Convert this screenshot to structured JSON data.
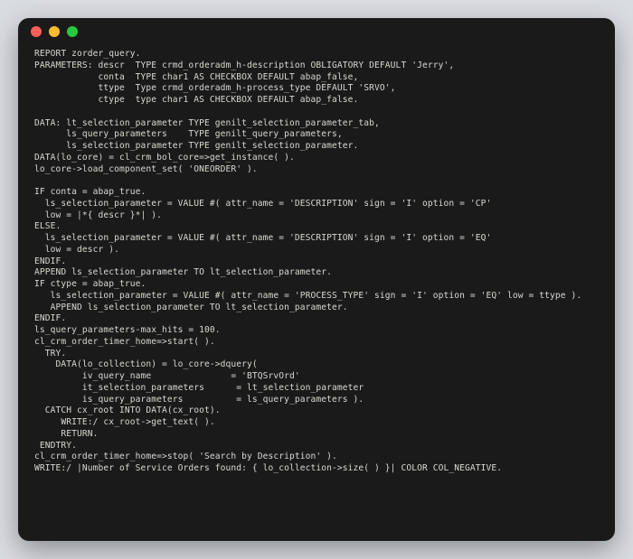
{
  "window": {
    "traffic_lights": {
      "close": "close",
      "minimize": "minimize",
      "maximize": "maximize"
    }
  },
  "code": "REPORT zorder_query.\nPARAMETERS: descr  TYPE crmd_orderadm_h-description OBLIGATORY DEFAULT 'Jerry',\n            conta  TYPE char1 AS CHECKBOX DEFAULT abap_false,\n            ttype  Type crmd_orderadm_h-process_type DEFAULT 'SRVO',\n            ctype  type char1 AS CHECKBOX DEFAULT abap_false.\n\nDATA: lt_selection_parameter TYPE genilt_selection_parameter_tab,\n      ls_query_parameters    TYPE genilt_query_parameters,\n      ls_selection_parameter TYPE genilt_selection_parameter.\nDATA(lo_core) = cl_crm_bol_core=>get_instance( ).\nlo_core->load_component_set( 'ONEORDER' ).\n\nIF conta = abap_true.\n  ls_selection_parameter = VALUE #( attr_name = 'DESCRIPTION' sign = 'I' option = 'CP'\n  low = |*{ descr }*| ).\nELSE.\n  ls_selection_parameter = VALUE #( attr_name = 'DESCRIPTION' sign = 'I' option = 'EQ'\n  low = descr ).\nENDIF.\nAPPEND ls_selection_parameter TO lt_selection_parameter.\nIF ctype = abap_true.\n   ls_selection_parameter = VALUE #( attr_name = 'PROCESS_TYPE' sign = 'I' option = 'EQ' low = ttype ).\n   APPEND ls_selection_parameter TO lt_selection_parameter.\nENDIF.\nls_query_parameters-max_hits = 100.\ncl_crm_order_timer_home=>start( ).\n  TRY.\n    DATA(lo_collection) = lo_core->dquery(\n         iv_query_name               = 'BTQSrvOrd'\n         it_selection_parameters      = lt_selection_parameter\n         is_query_parameters          = ls_query_parameters ).\n  CATCH cx_root INTO DATA(cx_root).\n     WRITE:/ cx_root->get_text( ).\n     RETURN.\n ENDTRY.\ncl_crm_order_timer_home=>stop( 'Search by Description' ).\nWRITE:/ |Number of Service Orders found: { lo_collection->size( ) }| COLOR COL_NEGATIVE."
}
